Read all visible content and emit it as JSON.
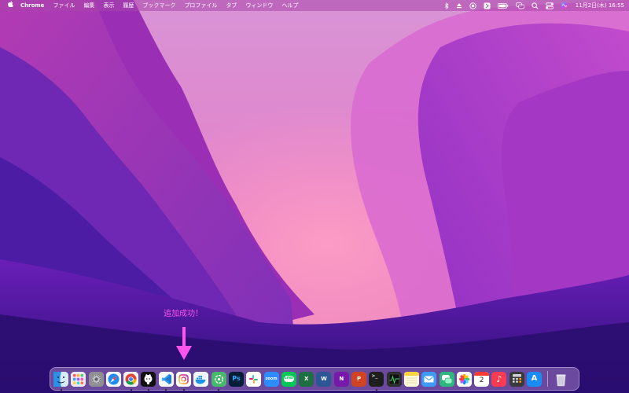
{
  "menubar": {
    "apple_icon": "apple-logo-icon",
    "app_name": "Chrome",
    "menus": [
      "ファイル",
      "編集",
      "表示",
      "履歴",
      "ブックマーク",
      "プロファイル",
      "タブ",
      "ウィンドウ",
      "ヘルプ"
    ],
    "status_icons": [
      "bluetooth-icon",
      "eject-icon",
      "screen-record-icon",
      "app-indicator-icon",
      "battery-icon",
      "messages-icon",
      "search-icon",
      "control-center-icon",
      "siri-icon"
    ],
    "clock": "11月2日(木) 16:55"
  },
  "annotation": {
    "text": "追加成功！",
    "color": "#ff55ee"
  },
  "dock": {
    "apps": [
      {
        "name": "finder",
        "icon": "finder-icon",
        "label": "",
        "running": true,
        "bg": "#4aa4f0"
      },
      {
        "name": "launchpad",
        "icon": "launchpad-icon",
        "label": "",
        "running": false,
        "bg": "#e9e4f2"
      },
      {
        "name": "system-settings",
        "icon": "gear-icon",
        "label": "",
        "running": false,
        "bg": "#8a8a8e"
      },
      {
        "name": "safari",
        "icon": "compass-icon",
        "label": "",
        "running": false,
        "bg": "#f4f7fb"
      },
      {
        "name": "chrome",
        "icon": "chrome-icon",
        "label": "",
        "running": true,
        "bg": "#ffffff"
      },
      {
        "name": "github-desktop",
        "icon": "github-icon",
        "label": "",
        "running": true,
        "bg": "#111111"
      },
      {
        "name": "vscode",
        "icon": "vscode-icon",
        "label": "",
        "running": true,
        "bg": "#f5f7fa"
      },
      {
        "name": "instagram",
        "icon": "instagram-icon",
        "label": "",
        "running": true,
        "bg": "#ffffff"
      },
      {
        "name": "docker",
        "icon": "docker-icon",
        "label": "",
        "running": false,
        "bg": "#eef5fb"
      },
      {
        "name": "chatgpt",
        "icon": "chatgpt-icon",
        "label": "",
        "running": true,
        "bg": "#48b86a"
      },
      {
        "name": "photoshop",
        "icon": "photoshop-icon",
        "label": "Ps",
        "running": false,
        "bg": "#001e36"
      },
      {
        "name": "slack",
        "icon": "slack-icon",
        "label": "",
        "running": false,
        "bg": "#ffffff"
      },
      {
        "name": "zoom",
        "icon": "zoom-icon",
        "label": "zoom",
        "running": false,
        "bg": "#2d8cff"
      },
      {
        "name": "line",
        "icon": "line-icon",
        "label": "LINE",
        "running": false,
        "bg": "#06c755"
      },
      {
        "name": "excel",
        "icon": "excel-icon",
        "label": "X",
        "running": false,
        "bg": "#1d6f42"
      },
      {
        "name": "word",
        "icon": "word-icon",
        "label": "W",
        "running": false,
        "bg": "#2b5797"
      },
      {
        "name": "onenote",
        "icon": "onenote-icon",
        "label": "N",
        "running": false,
        "bg": "#7719aa"
      },
      {
        "name": "powerpoint",
        "icon": "powerpoint-icon",
        "label": "P",
        "running": false,
        "bg": "#d04423"
      },
      {
        "name": "terminal",
        "icon": "terminal-icon",
        "label": ">_",
        "running": true,
        "bg": "#1e1e1e"
      },
      {
        "name": "activity-monitor",
        "icon": "activity-monitor-icon",
        "label": "",
        "running": false,
        "bg": "#2b2b2b"
      },
      {
        "name": "notes",
        "icon": "notes-icon",
        "label": "",
        "running": false,
        "bg": "#fef9d9"
      },
      {
        "name": "mail",
        "icon": "mail-icon",
        "label": "",
        "running": false,
        "bg": "#3d9bf5"
      },
      {
        "name": "messages",
        "icon": "chat-bubbles-icon",
        "label": "",
        "running": false,
        "bg": "#2fb87d"
      },
      {
        "name": "photos",
        "icon": "photos-icon",
        "label": "",
        "running": false,
        "bg": "#ffffff"
      },
      {
        "name": "calendar",
        "icon": "calendar-icon",
        "label": "2",
        "running": false,
        "bg": "#ffffff"
      },
      {
        "name": "music",
        "icon": "music-icon",
        "label": "♪",
        "running": false,
        "bg": "#fa3c52"
      },
      {
        "name": "calculator",
        "icon": "calculator-icon",
        "label": "",
        "running": false,
        "bg": "#3a3a3c"
      },
      {
        "name": "app-store",
        "icon": "app-store-icon",
        "label": "A",
        "running": false,
        "bg": "#1a8cf5"
      },
      {
        "name": "trash",
        "icon": "trash-icon",
        "label": "",
        "running": false,
        "bg": "transparent"
      }
    ]
  }
}
